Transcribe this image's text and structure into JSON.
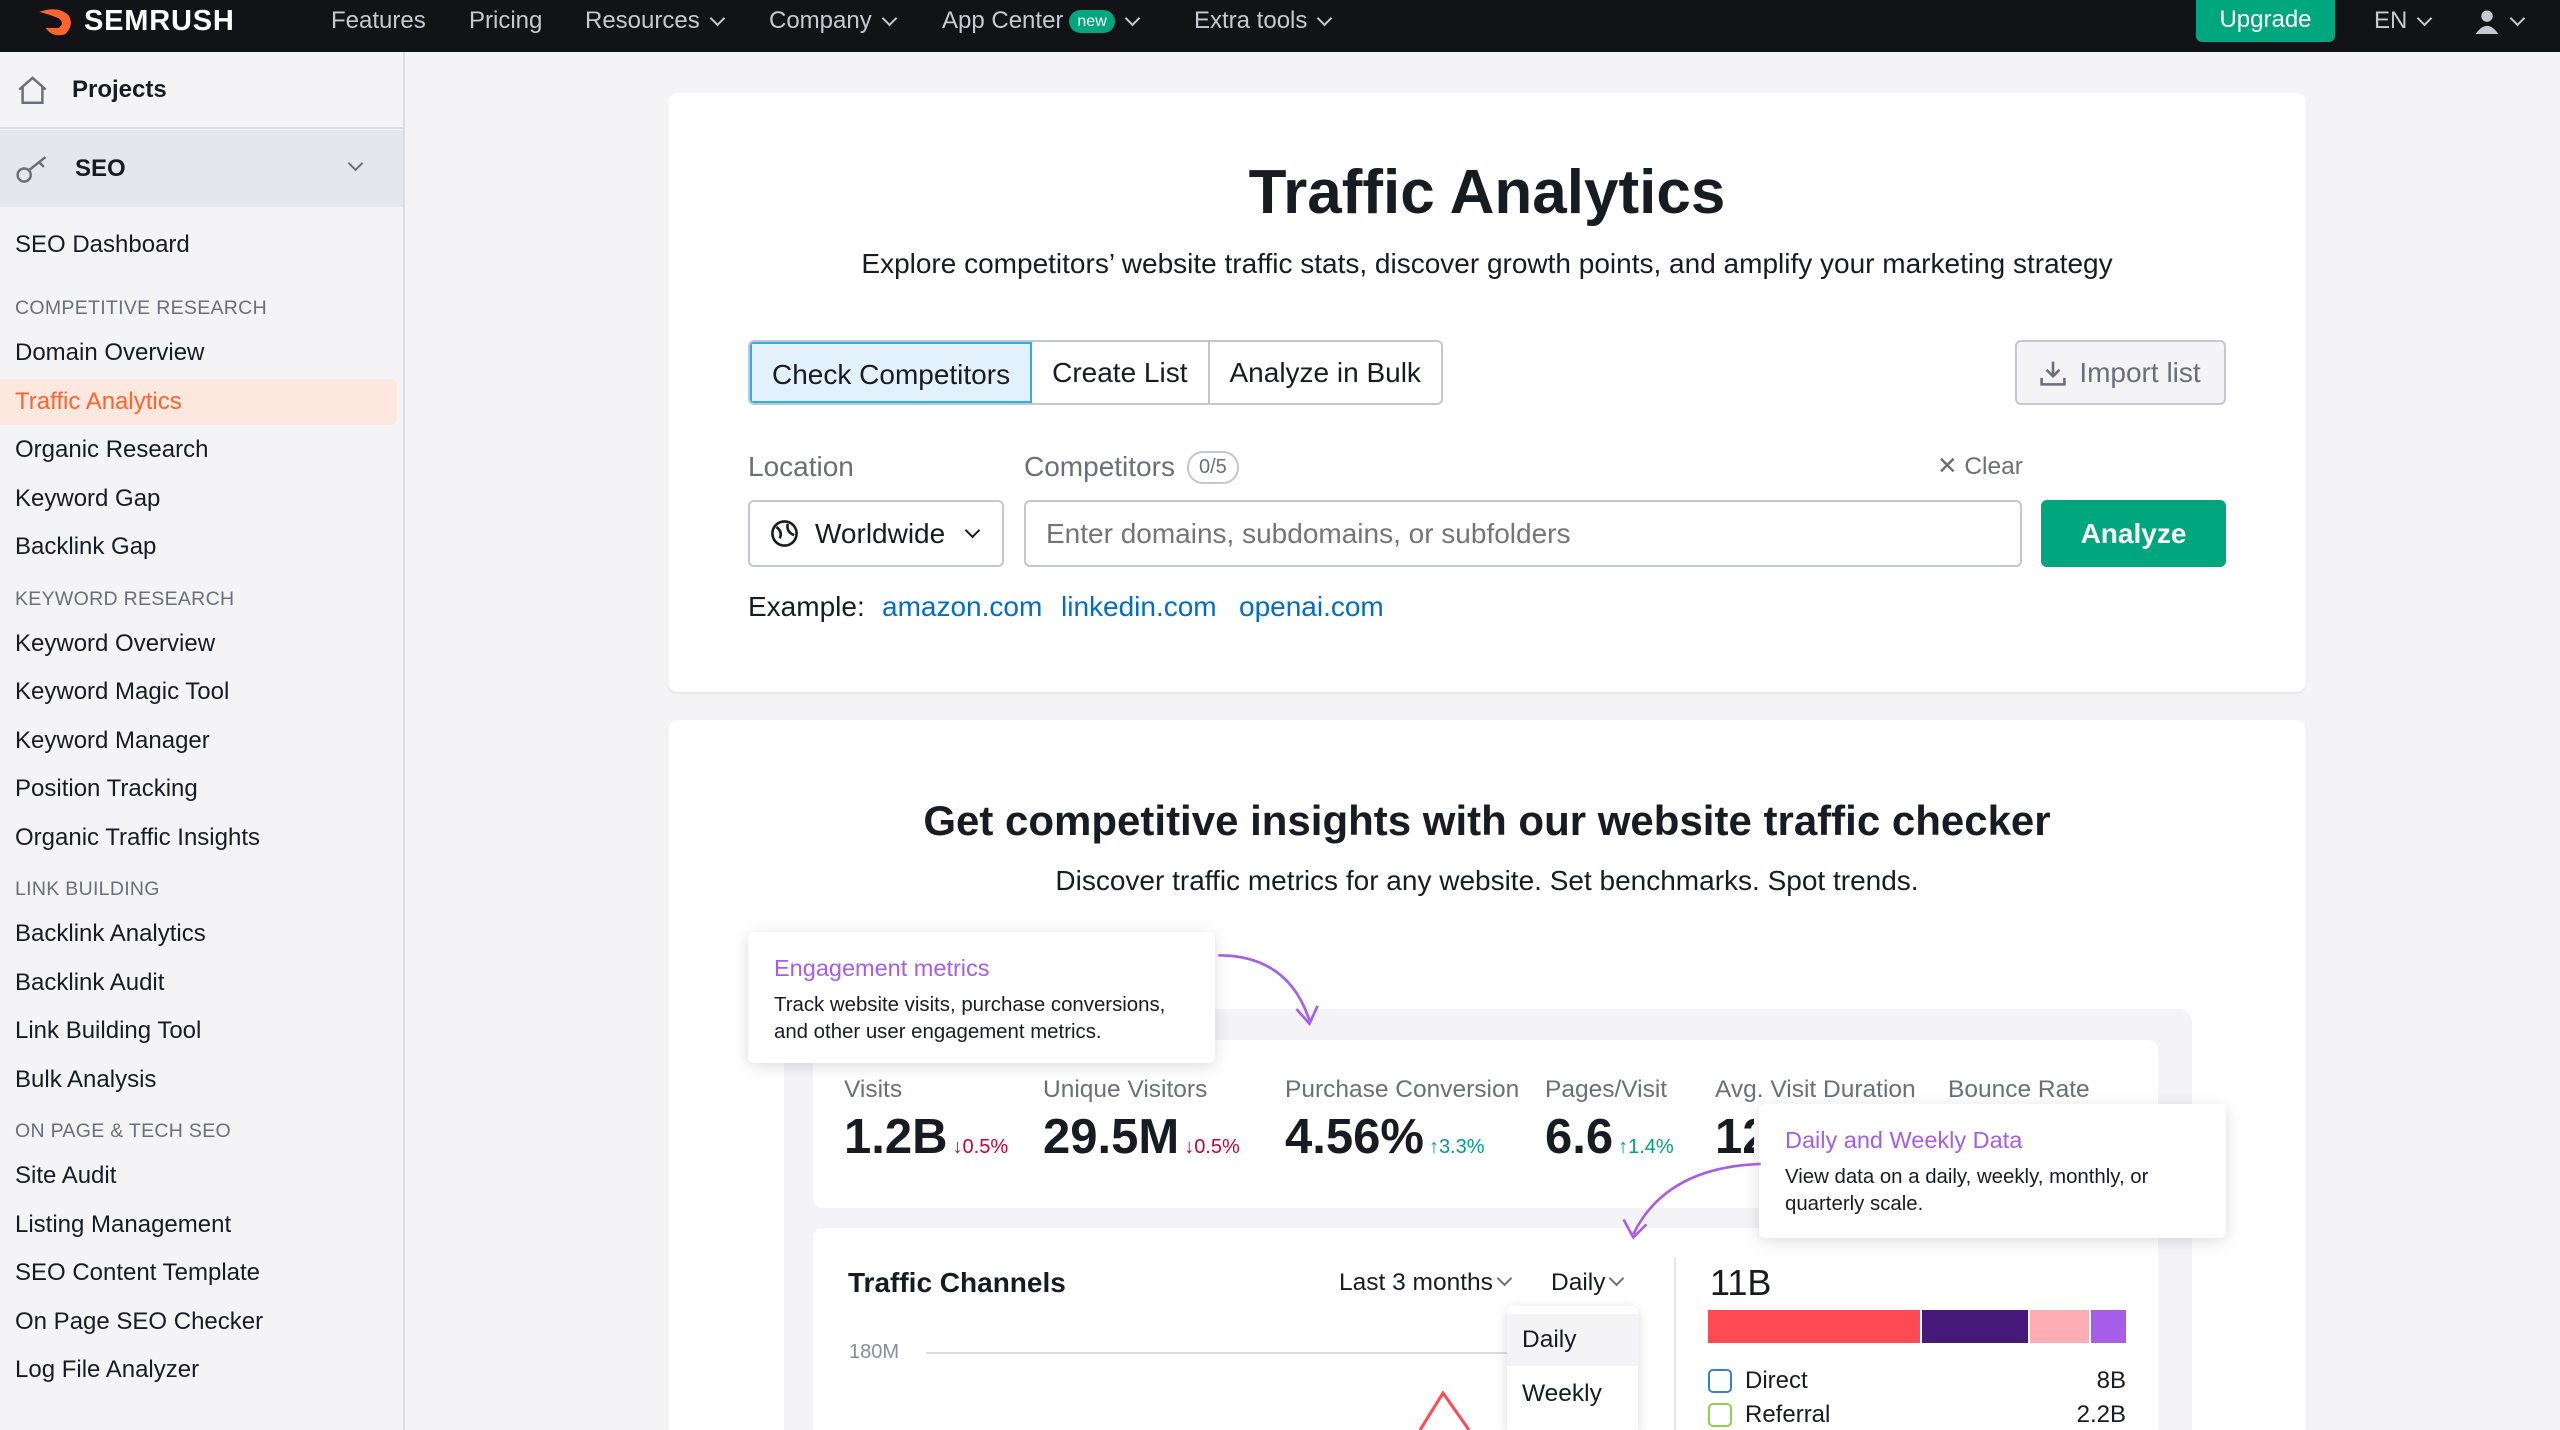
{
  "topbar": {
    "brand": "SEMRUSH",
    "nav": [
      "Features",
      "Pricing",
      "Resources",
      "Company",
      "App Center",
      "Extra tools"
    ],
    "new_badge": "new",
    "upgrade": "Upgrade",
    "lang": "EN"
  },
  "sidebar": {
    "projects": "Projects",
    "seo": "SEO",
    "dashboard": "SEO Dashboard",
    "sections": [
      {
        "heading": "COMPETITIVE RESEARCH",
        "items": [
          "Domain Overview",
          "Traffic Analytics",
          "Organic Research",
          "Keyword Gap",
          "Backlink Gap"
        ]
      },
      {
        "heading": "KEYWORD RESEARCH",
        "items": [
          "Keyword Overview",
          "Keyword Magic Tool",
          "Keyword Manager",
          "Position Tracking",
          "Organic Traffic Insights"
        ]
      },
      {
        "heading": "LINK BUILDING",
        "items": [
          "Backlink Analytics",
          "Backlink Audit",
          "Link Building Tool",
          "Bulk Analysis"
        ]
      },
      {
        "heading": "ON PAGE & TECH SEO",
        "items": [
          "Site Audit",
          "Listing Management",
          "SEO Content Template",
          "On Page SEO Checker",
          "Log File Analyzer"
        ]
      }
    ],
    "active": "Traffic Analytics"
  },
  "hero": {
    "title": "Traffic Analytics",
    "subtitle": "Explore competitors’ website traffic stats, discover growth points, and amplify your marketing strategy",
    "tabs": [
      "Check Competitors",
      "Create List",
      "Analyze in Bulk"
    ],
    "import": "Import list",
    "location_label": "Location",
    "location_value": "Worldwide",
    "competitors_label": "Competitors",
    "competitors_count": "0/5",
    "clear": "Clear",
    "input_placeholder": "Enter domains, subdomains, or subfolders",
    "analyze": "Analyze",
    "example_label": "Example:",
    "examples": [
      "amazon.com",
      "linkedin.com",
      "openai.com"
    ]
  },
  "insights": {
    "title": "Get competitive insights with our website traffic checker",
    "subtitle": "Discover traffic metrics for any website. Set benchmarks. Spot trends.",
    "tip1": {
      "title": "Engagement metrics",
      "text": "Track website visits, purchase conversions, and other user engagement metrics."
    },
    "tip2": {
      "title": "Daily and Weekly Data",
      "text": "View data on a daily, weekly, monthly, or quarterly scale."
    },
    "metrics": [
      {
        "label": "Visits",
        "value": "1.2B",
        "change": "0.5%",
        "dir": "down"
      },
      {
        "label": "Unique Visitors",
        "value": "29.5M",
        "change": "0.5%",
        "dir": "down"
      },
      {
        "label": "Purchase Conversion",
        "value": "4.56%",
        "change": "3.3%",
        "dir": "up"
      },
      {
        "label": "Pages/Visit",
        "value": "6.6",
        "change": "1.4%",
        "dir": "up"
      },
      {
        "label": "Avg. Visit Duration",
        "value": "12"
      },
      {
        "label": "Bounce Rate"
      }
    ],
    "channels": {
      "title": "Traffic Channels",
      "period": "Last 3 months",
      "granularity": "Daily",
      "options": [
        "Daily",
        "Weekly"
      ],
      "y_tick": "180M",
      "total": "11B",
      "bar_colors": [
        "#ff4953",
        "#461a7a",
        "#ffadb5",
        "#a75de8"
      ],
      "legend": [
        {
          "name": "Direct",
          "value": "8B",
          "color": "#3b7fc4"
        },
        {
          "name": "Referral",
          "value": "2.2B",
          "color": "#8bd34a"
        }
      ]
    }
  },
  "colors": {
    "accent": "#ff642d",
    "green": "#00a67e",
    "link": "#006dca",
    "purple": "#a75de8"
  }
}
